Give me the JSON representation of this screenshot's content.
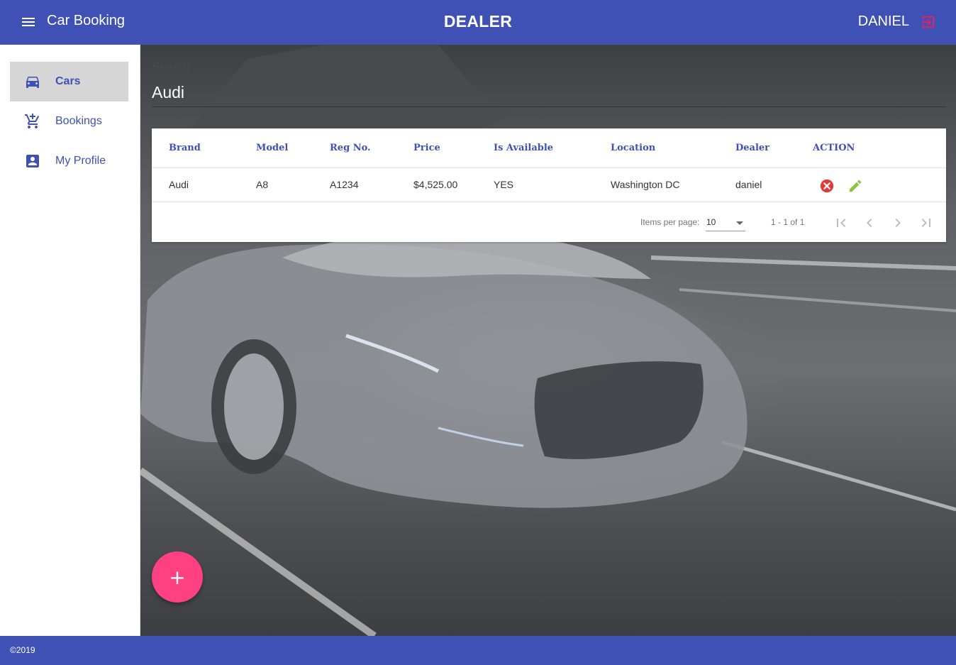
{
  "header": {
    "app_title": "Car Booking",
    "role_title": "DEALER",
    "user_name": "DANIEL",
    "menu_icon": "menu-icon",
    "logout_icon": "logout-icon"
  },
  "sidebar": {
    "items": [
      {
        "label": "Cars",
        "icon": "car-icon",
        "active": true
      },
      {
        "label": "Bookings",
        "icon": "add-shopping-cart-icon",
        "active": false
      },
      {
        "label": "My Profile",
        "icon": "account-box-icon",
        "active": false
      }
    ]
  },
  "search": {
    "label": "Search",
    "value": "Audi"
  },
  "table": {
    "columns": [
      "Brand",
      "Model",
      "Reg No.",
      "Price",
      "Is Available",
      "Location",
      "Dealer",
      "ACTION"
    ],
    "rows": [
      {
        "brand": "Audi",
        "model": "A8",
        "reg_no": "A1234",
        "price": "$4,525.00",
        "is_available": "YES",
        "location": "Washington DC",
        "dealer": "daniel"
      }
    ],
    "actions": [
      "delete-icon",
      "edit-icon"
    ]
  },
  "paginator": {
    "items_per_page_label": "Items per page:",
    "items_per_page_value": "10",
    "range_label": "1 - 1 of 1",
    "buttons": [
      "first-page-icon",
      "previous-page-icon",
      "next-page-icon",
      "last-page-icon"
    ]
  },
  "fab": {
    "label": "+"
  },
  "footer": {
    "copyright": "©2019"
  },
  "colors": {
    "primary": "#3f51b5",
    "accent": "#ff4081",
    "delete": "#e53935",
    "edit": "#8bc34a",
    "logout": "#e91e63"
  }
}
